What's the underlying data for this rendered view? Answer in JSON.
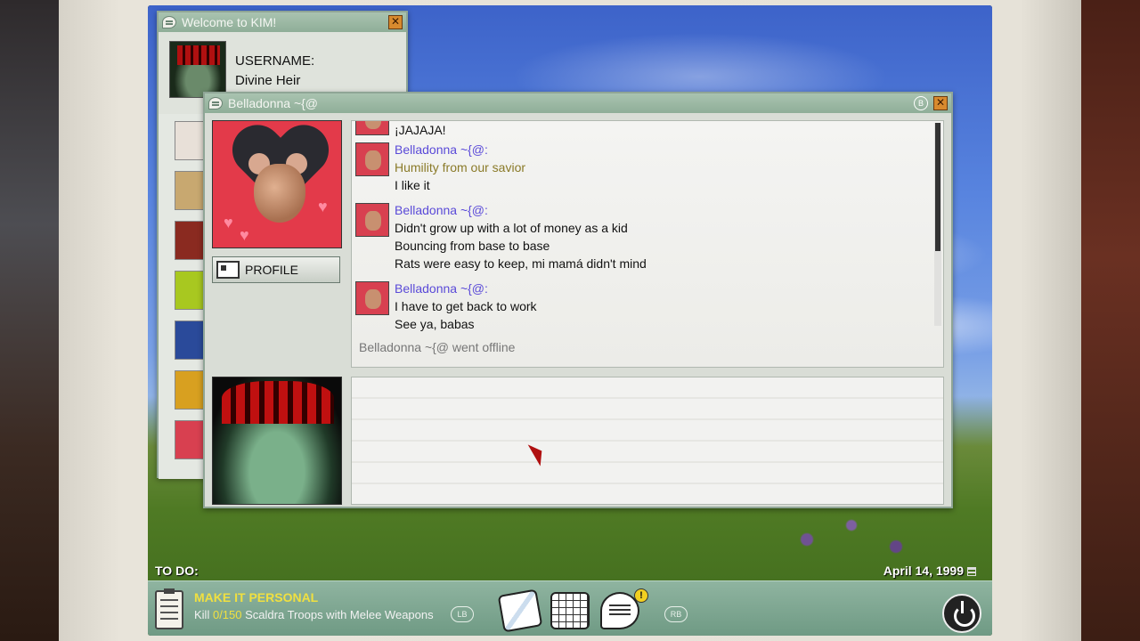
{
  "kim_window": {
    "title": "Welcome to KIM!",
    "username_label": "USERNAME:",
    "username": "Divine Heir",
    "contacts": [
      {
        "color": "#e8e0d8"
      },
      {
        "color": "#c8a870"
      },
      {
        "color": "#8a2a20"
      },
      {
        "color": "#a8c820"
      },
      {
        "color": "#2a4a9a"
      },
      {
        "color": "#d8a020"
      },
      {
        "color": "#d84050"
      }
    ]
  },
  "chat_window": {
    "title": "Belladonna ~{@",
    "badge": "B",
    "profile_label": "PROFILE",
    "messages": [
      {
        "name": "",
        "lines": [
          "¡JAJAJA!"
        ]
      },
      {
        "name": "Belladonna ~{@:",
        "lines": [
          "Humility from our savior",
          "I like it"
        ]
      },
      {
        "name": "Belladonna ~{@:",
        "lines": [
          "Didn't grow up with a lot of money as a kid",
          "Bouncing from base to base",
          "Rats were easy to keep, mi mamá didn't mind"
        ]
      },
      {
        "name": "Belladonna ~{@:",
        "lines": [
          "I have to get back to work",
          "See ya, babas"
        ]
      }
    ],
    "status": "Belladonna ~{@ went offline"
  },
  "taskbar": {
    "todo_label": "TO DO:",
    "date": "April 14, 1999",
    "quest_title": "MAKE IT PERSONAL",
    "quest_prefix": "Kill",
    "quest_progress": "0/150",
    "quest_suffix": "Scaldra Troops with Melee Weapons",
    "lb": "LB",
    "rb": "RB",
    "notification": "!",
    "icons": [
      "map-icon",
      "calendar-icon",
      "chat-icon",
      "power-icon"
    ]
  },
  "colors": {
    "accent_gold": "#f0e040",
    "chat_name": "#5a4ad8",
    "window_title": "#8fae98"
  }
}
